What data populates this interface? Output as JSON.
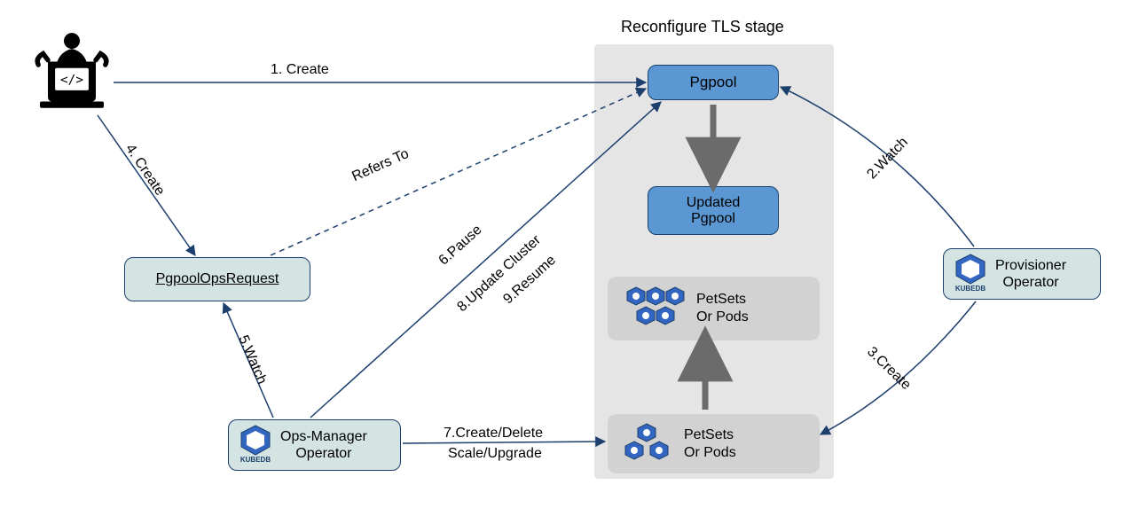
{
  "diagram_title": "Reconfigure TLS stage",
  "nodes": {
    "user": "User",
    "pgpool": "Pgpool",
    "updated_pgpool_line1": "Updated",
    "updated_pgpool_line2": "Pgpool",
    "petsets1_line1": "PetSets",
    "petsets1_line2": "Or Pods",
    "petsets2_line1": "PetSets",
    "petsets2_line2": "Or Pods",
    "pgpool_ops_request": "PgpoolOpsRequest",
    "ops_manager_line1": "Ops-Manager",
    "ops_manager_line2": "Operator",
    "provisioner_line1": "Provisioner",
    "provisioner_line2": "Operator",
    "kubedb_brand": "KᴜbeDB"
  },
  "edges": {
    "create1": "1. Create",
    "watch2": "2.Watch",
    "create3": "3.Create",
    "create4": "4. Create",
    "watch5": "5.Watch",
    "pause6": "6.Pause",
    "cd_scale7a": "7.Create/Delete",
    "cd_scale7b": "Scale/Upgrade",
    "update8": "8.Update Cluster",
    "resume9": "9.Resume",
    "refers_to": "Refers To"
  }
}
